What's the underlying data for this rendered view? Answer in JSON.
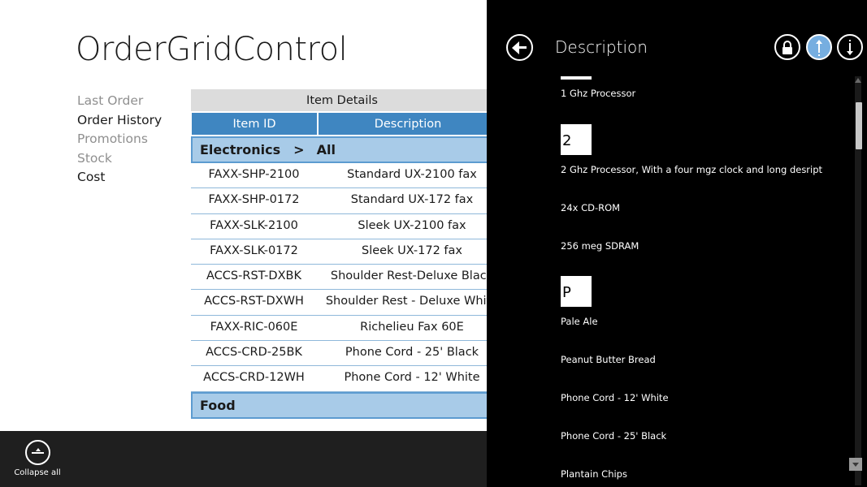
{
  "app": {
    "title": "OrderGridControl",
    "nav": [
      "Last Order",
      "Order History",
      "Promotions",
      "Stock",
      "Cost"
    ]
  },
  "grid": {
    "group_header": "Item Details",
    "columns": [
      "Item ID",
      "Description"
    ],
    "category1": {
      "name": "Electronics",
      "sep": ">",
      "sub": "All"
    },
    "rows": [
      {
        "id": "FAXX-SHP-2100",
        "desc": "Standard UX-2100 fax"
      },
      {
        "id": "FAXX-SHP-0172",
        "desc": "Standard UX-172 fax"
      },
      {
        "id": "FAXX-SLK-2100",
        "desc": "Sleek UX-2100 fax"
      },
      {
        "id": "FAXX-SLK-0172",
        "desc": "Sleek UX-172 fax"
      },
      {
        "id": "ACCS-RST-DXBK",
        "desc": "Shoulder Rest-Deluxe Black"
      },
      {
        "id": "ACCS-RST-DXWH",
        "desc": "Shoulder Rest - Deluxe White"
      },
      {
        "id": "FAXX-RIC-060E",
        "desc": "Richelieu Fax 60E"
      },
      {
        "id": "ACCS-CRD-25BK",
        "desc": "Phone Cord - 25' Black"
      },
      {
        "id": "ACCS-CRD-12WH",
        "desc": "Phone Cord - 12' White"
      }
    ],
    "category2": {
      "name": "Food"
    }
  },
  "app_bar": {
    "collapse_label": "Collapse all",
    "icon": "collapse-all-icon"
  },
  "flyout": {
    "title": "Description",
    "icons": [
      "back-arrow-icon",
      "lock-icon",
      "sort-ascending-icon",
      "sort-descending-icon"
    ],
    "items": {
      "i1": "1 Ghz Processor",
      "h2": "2",
      "i2": "2 Ghz Processor, With a four mgz clock and long desript",
      "i3": "24x CD-ROM",
      "i4": "256 meg SDRAM",
      "hP": "P",
      "i5": "Pale Ale",
      "i6": "Peanut Butter Bread",
      "i7": "Phone Cord - 12' White",
      "i8": "Phone Cord - 25' Black",
      "i9": "Plantain Chips"
    }
  },
  "colors": {
    "column_header": "#3f86c1",
    "category_row": "#a8cbe8",
    "accent_button": "#76aee0",
    "app_bar": "#1f1f1f",
    "flyout_bg": "#000000"
  }
}
